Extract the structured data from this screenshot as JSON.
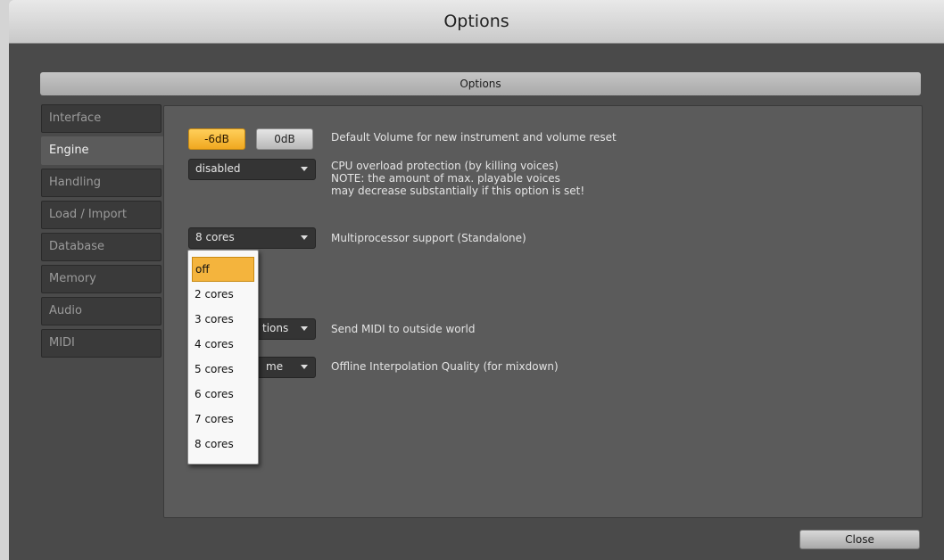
{
  "window": {
    "title": "Options"
  },
  "header": {
    "title": "Options"
  },
  "tabs": [
    "Interface",
    "Engine",
    "Handling",
    "Load / Import",
    "Database",
    "Memory",
    "Audio",
    "MIDI"
  ],
  "engine": {
    "volume_minus6": "-6dB",
    "volume_0": "0dB",
    "volume_desc": "Default Volume for new instrument and volume reset",
    "cpu_value": "disabled",
    "cpu_desc1": "CPU overload protection (by killing voices)",
    "cpu_desc2": "NOTE: the amount of max. playable voices",
    "cpu_desc3": "may decrease substantially if this option is set!",
    "mp_value": "8 cores",
    "mp_desc": "Multiprocessor support  (Standalone)",
    "midi_value_visible": "tions",
    "midi_desc": "Send MIDI to outside world",
    "interp_value_visible": "me",
    "interp_desc": "Offline Interpolation Quality (for mixdown)"
  },
  "dropdown_menu": [
    "off",
    "2 cores",
    "3 cores",
    "4 cores",
    "5 cores",
    "6 cores",
    "7 cores",
    "8 cores"
  ],
  "footer": {
    "close_label": "Close"
  },
  "colors": {
    "accent": "#f4b43d",
    "panel": "#5b5b5b",
    "background": "#4a4a4a"
  }
}
